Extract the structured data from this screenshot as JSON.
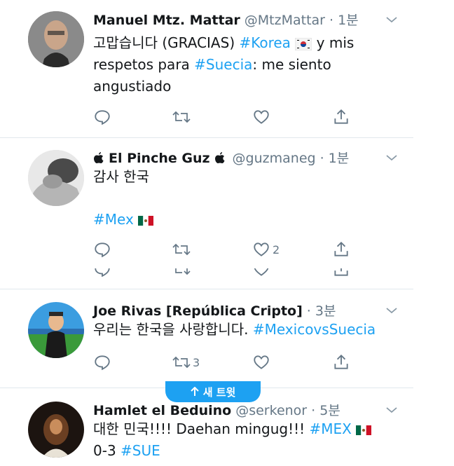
{
  "tweets": [
    {
      "name": "Manuel Mtz. Mattar",
      "handle": "@MtzMattar · 1분",
      "line1": "고맙습니다 (GRACIAS) ",
      "tag1": "#Korea",
      "line1b": " y mis",
      "line2a": "respetos para ",
      "tag2": "#Suecia",
      "line2b": ": me siento",
      "line3": "angustiado"
    },
    {
      "name": "El Pinche Guz",
      "handle": "@guzmaneg · 1분",
      "text": "감사 한국",
      "tag": "#Mex",
      "like_count": "2"
    },
    {
      "name": "Joe Rivas [República Cripto]",
      "handle": "· 3분",
      "text": "우리는 한국을 사랑합니다. ",
      "tag": "#MexicovsSuecia",
      "retweet_count": "3"
    },
    {
      "name": "Hamlet el Beduino",
      "handle": "@serkenor · 5분",
      "text": "대한 민국!!!! Daehan mingug!!! ",
      "tag": "#MEX",
      "line2": "0-3 ",
      "tag2": "#SUE"
    }
  ],
  "new_tweets_label": "새 트윗",
  "icons": [
    "reply-icon",
    "retweet-icon",
    "like-icon",
    "share-icon",
    "chevron-down-icon",
    "apple-icon",
    "arrow-up-icon"
  ],
  "colors": {
    "accent": "#1da1f2",
    "muted": "#657786",
    "text": "#14171a",
    "divider": "#e1e8ed"
  }
}
